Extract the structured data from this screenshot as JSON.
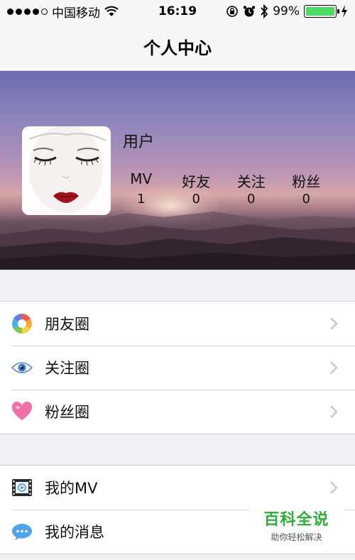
{
  "status_bar": {
    "carrier": "中国移动",
    "time": "16:19",
    "battery": "99%",
    "battery_level": 0.99
  },
  "nav": {
    "title": "个人中心"
  },
  "profile": {
    "username": "用户",
    "stats": [
      {
        "label": "MV",
        "value": "1"
      },
      {
        "label": "好友",
        "value": "0"
      },
      {
        "label": "关注",
        "value": "0"
      },
      {
        "label": "粉丝",
        "value": "0"
      }
    ]
  },
  "menu_group_1": [
    {
      "label": "朋友圈",
      "icon": "aperture-icon"
    },
    {
      "label": "关注圈",
      "icon": "eye-icon"
    },
    {
      "label": "粉丝圈",
      "icon": "heart-icon"
    }
  ],
  "menu_group_2": [
    {
      "label": "我的MV",
      "icon": "film-icon"
    },
    {
      "label": "我的消息",
      "icon": "chat-bubble-icon"
    }
  ],
  "watermark": {
    "title": "百科全说",
    "subtitle": "助你轻松解决"
  },
  "colors": {
    "battery_fill": "#4cd964",
    "watermark_green": "#2fae3b",
    "heart_pink": "#f06fa6",
    "chat_blue": "#4fa3e8"
  }
}
